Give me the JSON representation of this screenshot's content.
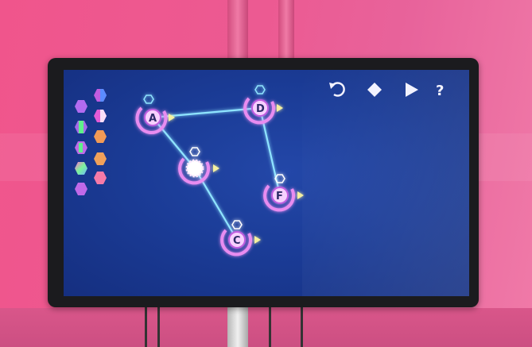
{
  "colors": {
    "wall": "#ec5a92",
    "screen": "#1b3c97",
    "node_ring": "#e88cf0",
    "link": "#8fe4ff",
    "bezel": "#1b1b1e"
  },
  "toolbar": {
    "reset_icon": "refresh-icon",
    "shape_icon": "diamond-icon",
    "play_icon": "play-icon",
    "help_label": "?"
  },
  "palette": {
    "tiles": [
      {
        "icon": "hex-purple-icon"
      },
      {
        "icon": "hex-split-blue-icon"
      },
      {
        "icon": "hex-purple-green-icon"
      },
      {
        "icon": "hex-split-orange-icon"
      },
      {
        "icon": "hex-purple-green-icon"
      },
      {
        "icon": "hex-orange-icon"
      },
      {
        "icon": "hex-rainbow-icon"
      },
      {
        "icon": "hex-orange-pink-icon"
      },
      {
        "icon": "hex-purple-icon"
      }
    ]
  },
  "nodes": [
    {
      "id": "A",
      "label": "A"
    },
    {
      "id": "D",
      "label": "D"
    },
    {
      "id": "E",
      "label": ""
    },
    {
      "id": "F",
      "label": "F"
    },
    {
      "id": "C",
      "label": "C"
    }
  ],
  "links": [
    {
      "from": "A",
      "to": "D"
    },
    {
      "from": "A",
      "to": "E"
    },
    {
      "from": "E",
      "to": "C"
    },
    {
      "from": "D",
      "to": "F"
    }
  ]
}
